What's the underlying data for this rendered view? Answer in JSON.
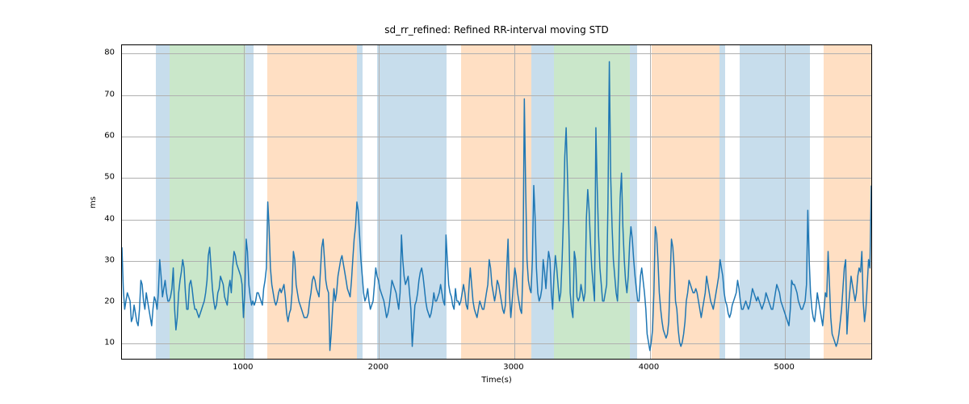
{
  "chart_data": {
    "type": "line",
    "title": "sd_rr_refined: Refined RR-interval moving STD",
    "xlabel": "Time(s)",
    "ylabel": "ms",
    "xlim": [
      100,
      5650
    ],
    "ylim": [
      6,
      82
    ],
    "xticks": [
      1000,
      2000,
      3000,
      4000,
      5000
    ],
    "yticks": [
      10,
      20,
      30,
      40,
      50,
      60,
      70,
      80
    ],
    "bands": [
      {
        "x0": 350,
        "x1": 455,
        "color": "blue"
      },
      {
        "x0": 455,
        "x1": 1015,
        "color": "green"
      },
      {
        "x0": 1015,
        "x1": 1070,
        "color": "blue"
      },
      {
        "x0": 1175,
        "x1": 1835,
        "color": "orange"
      },
      {
        "x0": 1835,
        "x1": 1880,
        "color": "blue"
      },
      {
        "x0": 1985,
        "x1": 2500,
        "color": "blue"
      },
      {
        "x0": 2605,
        "x1": 3125,
        "color": "orange"
      },
      {
        "x0": 3125,
        "x1": 3295,
        "color": "blue"
      },
      {
        "x0": 3295,
        "x1": 3855,
        "color": "green"
      },
      {
        "x0": 3855,
        "x1": 3910,
        "color": "blue"
      },
      {
        "x0": 4015,
        "x1": 4515,
        "color": "orange"
      },
      {
        "x0": 4515,
        "x1": 4560,
        "color": "blue"
      },
      {
        "x0": 4665,
        "x1": 5185,
        "color": "blue"
      },
      {
        "x0": 5285,
        "x1": 5650,
        "color": "orange"
      }
    ],
    "series": [
      {
        "name": "sd_rr_refined",
        "x_start": 100,
        "x_step": 10,
        "values": [
          33,
          23,
          18,
          20,
          22,
          21,
          20,
          15,
          16,
          19,
          17,
          15,
          14,
          18,
          25,
          24,
          20,
          18,
          22,
          20,
          18,
          16,
          14,
          18,
          21,
          20,
          18,
          22,
          30,
          26,
          21,
          23,
          25,
          22,
          20,
          20,
          21,
          23,
          28,
          18,
          13,
          16,
          22,
          25,
          27,
          30,
          28,
          22,
          18,
          18,
          24,
          25,
          23,
          20,
          18,
          18,
          17,
          16,
          17,
          18,
          19,
          20,
          22,
          25,
          31,
          33,
          28,
          23,
          20,
          18,
          19,
          22,
          23,
          26,
          25,
          24,
          21,
          20,
          19,
          23,
          25,
          22,
          28,
          32,
          31,
          29,
          28,
          27,
          26,
          24,
          16,
          22,
          35,
          32,
          24,
          21,
          19,
          20,
          19,
          20,
          22,
          22,
          21,
          20,
          19,
          23,
          25,
          28,
          44,
          38,
          28,
          24,
          22,
          20,
          19,
          20,
          22,
          23,
          22,
          23,
          24,
          21,
          17,
          15,
          17,
          18,
          22,
          32,
          30,
          24,
          22,
          20,
          19,
          18,
          17,
          16,
          16,
          16,
          17,
          20,
          22,
          25,
          26,
          25,
          23,
          22,
          21,
          27,
          33,
          35,
          30,
          25,
          23,
          22,
          8,
          12,
          18,
          23,
          20,
          22,
          26,
          28,
          30,
          31,
          29,
          27,
          25,
          23,
          22,
          21,
          25,
          30,
          35,
          38,
          44,
          42,
          36,
          30,
          26,
          22,
          20,
          21,
          23,
          20,
          18,
          19,
          20,
          24,
          28,
          26,
          25,
          23,
          22,
          21,
          20,
          18,
          16,
          17,
          19,
          22,
          25,
          24,
          23,
          22,
          20,
          18,
          22,
          36,
          30,
          26,
          24,
          25,
          26,
          22,
          18,
          9,
          14,
          19,
          20,
          22,
          25,
          27,
          28,
          26,
          23,
          20,
          18,
          17,
          16,
          17,
          19,
          22,
          20,
          20,
          21,
          22,
          24,
          22,
          20,
          19,
          36,
          30,
          24,
          22,
          21,
          19,
          18,
          23,
          20,
          20,
          19,
          20,
          22,
          24,
          22,
          19,
          18,
          23,
          28,
          24,
          20,
          18,
          17,
          16,
          18,
          20,
          19,
          18,
          18,
          20,
          22,
          24,
          30,
          28,
          24,
          22,
          20,
          22,
          25,
          24,
          22,
          20,
          18,
          17,
          19,
          28,
          35,
          22,
          16,
          20,
          24,
          28,
          26,
          22,
          20,
          18,
          17,
          28,
          69,
          48,
          30,
          25,
          23,
          22,
          30,
          48,
          40,
          28,
          22,
          20,
          21,
          23,
          30,
          27,
          23,
          28,
          32,
          30,
          22,
          18,
          26,
          31,
          28,
          24,
          20,
          22,
          30,
          40,
          55,
          62,
          50,
          38,
          22,
          18,
          16,
          32,
          30,
          21,
          20,
          21,
          24,
          22,
          20,
          22,
          40,
          47,
          42,
          34,
          28,
          24,
          20,
          62,
          48,
          36,
          28,
          24,
          20,
          20,
          22,
          24,
          44,
          78,
          50,
          38,
          30,
          26,
          22,
          20,
          28,
          45,
          51,
          38,
          30,
          25,
          22,
          26,
          34,
          38,
          35,
          30,
          26,
          23,
          20,
          20,
          26,
          28,
          25,
          22,
          18,
          12,
          10,
          8,
          10,
          13,
          22,
          38,
          36,
          30,
          22,
          18,
          15,
          13,
          12,
          11,
          12,
          15,
          25,
          35,
          33,
          28,
          20,
          18,
          13,
          10,
          9,
          10,
          12,
          15,
          20,
          22,
          25,
          24,
          23,
          22,
          22,
          23,
          22,
          20,
          18,
          16,
          18,
          20,
          22,
          26,
          24,
          22,
          20,
          19,
          18,
          20,
          22,
          24,
          26,
          30,
          28,
          26,
          22,
          20,
          19,
          17,
          16,
          17,
          19,
          20,
          21,
          22,
          25,
          23,
          20,
          18,
          18,
          19,
          20,
          19,
          18,
          19,
          21,
          23,
          22,
          21,
          20,
          21,
          20,
          19,
          18,
          19,
          20,
          22,
          21,
          20,
          19,
          18,
          18,
          20,
          22,
          24,
          23,
          22,
          20,
          19,
          18,
          17,
          16,
          15,
          14,
          18,
          25,
          24,
          24,
          23,
          22,
          20,
          19,
          18,
          18,
          19,
          20,
          24,
          42,
          30,
          22,
          18,
          16,
          15,
          18,
          22,
          20,
          18,
          16,
          14,
          18,
          22,
          21,
          32,
          24,
          16,
          12,
          11,
          10,
          9,
          10,
          12,
          15,
          18,
          23,
          28,
          30,
          12,
          18,
          22,
          26,
          24,
          22,
          20,
          22,
          26,
          28,
          27,
          32,
          20,
          15,
          18,
          24,
          30,
          28,
          48
        ]
      }
    ]
  }
}
